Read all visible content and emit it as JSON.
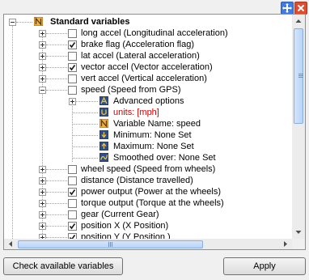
{
  "tree": {
    "root_label": "Standard variables",
    "items": [
      {
        "label": "long accel  (Longitudinal acceleration)",
        "checked": false
      },
      {
        "label": "brake flag  (Acceleration flag)",
        "checked": true
      },
      {
        "label": "lat accel  (Lateral acceleration)",
        "checked": false
      },
      {
        "label": "vector accel  (Vector acceleration)",
        "checked": true
      },
      {
        "label": "vert accel  (Vertical acceleration)",
        "checked": false
      },
      {
        "label": "speed  (Speed from GPS)",
        "checked": false,
        "expanded": true
      },
      {
        "label": "wheel speed  (Speed from wheels)",
        "checked": false
      },
      {
        "label": "distance  (Distance travelled)",
        "checked": false
      },
      {
        "label": "power output  (Power at the wheels)",
        "checked": true
      },
      {
        "label": "torque output  (Torque at the wheels)",
        "checked": false
      },
      {
        "label": "gear  (Current Gear)",
        "checked": false
      },
      {
        "label": "position X  (X Position)",
        "checked": true
      },
      {
        "label": "position Y  (Y Position )",
        "checked": true
      }
    ],
    "speed_children": [
      {
        "label": "Advanced options",
        "icon": "advanced-options-icon",
        "expandable": true
      },
      {
        "label": "units: [mph]",
        "icon": "units-icon",
        "highlight": "#d00000"
      },
      {
        "label": "Variable Name: speed",
        "icon": "variable-name-icon"
      },
      {
        "label": "Minimum: None Set",
        "icon": "minimum-icon"
      },
      {
        "label": "Maximum: None Set",
        "icon": "maximum-icon"
      },
      {
        "label": "Smoothed over: None Set",
        "icon": "smoothing-icon"
      }
    ]
  },
  "buttons": {
    "check_label": "Check available variables",
    "apply_label": "Apply"
  },
  "colors": {
    "pin_button": "#3f7be0",
    "close_button": "#e04a2f",
    "units_text": "#d00000",
    "scroll_thumb": "#c6dcf8"
  },
  "icons": {
    "pin": "pin-icon",
    "close": "close-icon",
    "root": "variables-folder-icon"
  }
}
